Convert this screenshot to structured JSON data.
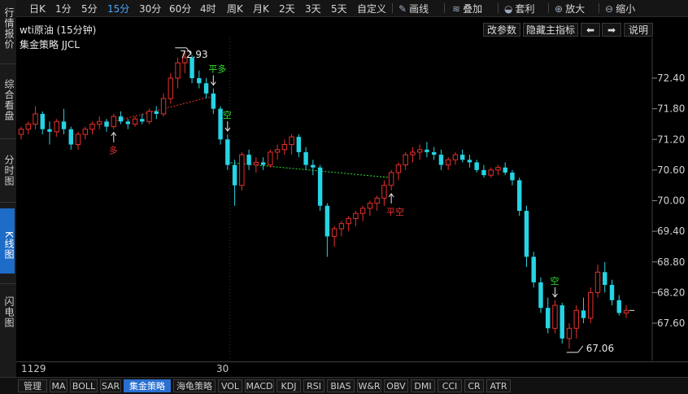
{
  "sidebar": {
    "items": [
      {
        "label": "行情报价",
        "active": false
      },
      {
        "label": "综合看盘",
        "active": false
      },
      {
        "label": "分时图",
        "active": false
      },
      {
        "label": "K线图",
        "active": true
      },
      {
        "label": "闪电图",
        "active": false
      }
    ]
  },
  "toolbar": {
    "periods": [
      "日K",
      "1分",
      "5分",
      "15分",
      "30分",
      "60分",
      "4时",
      "周K",
      "月K",
      "2天",
      "3天",
      "5天",
      "自定义"
    ],
    "active_period": "15分",
    "tools": [
      {
        "label": "画线",
        "icon": "pencil-icon"
      },
      {
        "label": "叠加",
        "icon": "layers-icon"
      },
      {
        "label": "套利",
        "icon": "bag-icon"
      },
      {
        "label": "放大",
        "icon": "zoom-in-icon"
      },
      {
        "label": "缩小",
        "icon": "zoom-out-icon"
      }
    ]
  },
  "chart_header": {
    "title": "wti原油 (15分钟)",
    "strategy": "集金策略 JJCL",
    "buttons": {
      "params": "改参数",
      "hide": "隐藏主指标",
      "prev": "⬅",
      "next": "➡",
      "help": "说明"
    }
  },
  "chart_data": {
    "type": "candlestick",
    "ylim": [
      67.0,
      72.9
    ],
    "yticks": [
      "72.40",
      "71.80",
      "71.20",
      "70.60",
      "70.00",
      "69.40",
      "68.80",
      "68.20",
      "67.60"
    ],
    "xlabels": [
      {
        "label": "1129",
        "index": 0
      },
      {
        "label": "30",
        "index": 30
      }
    ],
    "colors": {
      "up": "#e8302c",
      "down": "#26d4e4",
      "grid": "#2a2a2a",
      "trend": "#ff3030",
      "trend2": "#31e231"
    },
    "annotations": [
      {
        "text": "72.93",
        "index": 23,
        "price": 72.93
      },
      {
        "text": "67.06",
        "index": 78,
        "price": 67.06
      }
    ],
    "signals": [
      {
        "text": "多",
        "index": 13,
        "dir": "up",
        "color": "#e8302c"
      },
      {
        "text": "平多",
        "index": 27,
        "dir": "down",
        "color": "#31e231"
      },
      {
        "text": "空",
        "index": 29,
        "dir": "down",
        "color": "#31e231"
      },
      {
        "text": "平空",
        "index": 52,
        "dir": "up",
        "color": "#e8302c"
      },
      {
        "text": "空",
        "index": 75,
        "dir": "down",
        "color": "#31e231"
      }
    ],
    "trendlines": [
      {
        "from": [
          13,
          71.55
        ],
        "to": [
          27,
          72.05
        ],
        "color": "#ff3030"
      },
      {
        "from": [
          29,
          70.75
        ],
        "to": [
          52,
          70.45
        ],
        "color": "#31e231"
      }
    ],
    "candles": [
      [
        71.3,
        71.45,
        71.2,
        71.4
      ],
      [
        71.4,
        71.55,
        71.3,
        71.5
      ],
      [
        71.5,
        71.85,
        71.4,
        71.7
      ],
      [
        71.7,
        71.75,
        71.3,
        71.4
      ],
      [
        71.4,
        71.55,
        71.1,
        71.35
      ],
      [
        71.35,
        71.6,
        71.25,
        71.55
      ],
      [
        71.55,
        71.8,
        71.3,
        71.4
      ],
      [
        71.4,
        71.45,
        71.0,
        71.1
      ],
      [
        71.1,
        71.35,
        71.0,
        71.3
      ],
      [
        71.3,
        71.45,
        71.2,
        71.4
      ],
      [
        71.4,
        71.55,
        71.3,
        71.5
      ],
      [
        71.5,
        71.65,
        71.4,
        71.55
      ],
      [
        71.55,
        71.6,
        71.35,
        71.45
      ],
      [
        71.45,
        71.7,
        71.4,
        71.65
      ],
      [
        71.65,
        71.75,
        71.5,
        71.55
      ],
      [
        71.55,
        71.6,
        71.4,
        71.5
      ],
      [
        71.5,
        71.65,
        71.45,
        71.6
      ],
      [
        71.6,
        71.7,
        71.5,
        71.55
      ],
      [
        71.55,
        71.8,
        71.5,
        71.75
      ],
      [
        71.75,
        71.85,
        71.6,
        71.7
      ],
      [
        71.7,
        72.1,
        71.65,
        72.0
      ],
      [
        72.0,
        72.5,
        71.9,
        72.4
      ],
      [
        72.4,
        72.8,
        72.2,
        72.7
      ],
      [
        72.7,
        72.93,
        72.5,
        72.8
      ],
      [
        72.8,
        72.85,
        72.3,
        72.4
      ],
      [
        72.4,
        72.55,
        72.2,
        72.3
      ],
      [
        72.3,
        72.4,
        72.0,
        72.1
      ],
      [
        72.1,
        72.2,
        71.7,
        71.8
      ],
      [
        71.8,
        71.85,
        71.1,
        71.2
      ],
      [
        71.2,
        71.3,
        70.6,
        70.7
      ],
      [
        70.7,
        70.8,
        69.9,
        70.3
      ],
      [
        70.3,
        70.95,
        70.2,
        70.9
      ],
      [
        70.9,
        71.0,
        70.6,
        70.7
      ],
      [
        70.7,
        70.85,
        70.55,
        70.75
      ],
      [
        70.75,
        70.85,
        70.6,
        70.7
      ],
      [
        70.7,
        71.0,
        70.65,
        70.95
      ],
      [
        70.95,
        71.1,
        70.8,
        71.0
      ],
      [
        71.0,
        71.2,
        70.9,
        71.1
      ],
      [
        71.1,
        71.3,
        70.9,
        71.25
      ],
      [
        71.25,
        71.3,
        70.85,
        70.95
      ],
      [
        70.95,
        71.05,
        70.6,
        70.7
      ],
      [
        70.7,
        70.8,
        70.5,
        70.65
      ],
      [
        70.65,
        70.7,
        69.8,
        69.9
      ],
      [
        69.9,
        69.95,
        68.9,
        69.3
      ],
      [
        69.3,
        69.5,
        69.1,
        69.45
      ],
      [
        69.45,
        69.6,
        69.3,
        69.55
      ],
      [
        69.55,
        69.7,
        69.4,
        69.65
      ],
      [
        69.65,
        69.8,
        69.5,
        69.75
      ],
      [
        69.75,
        69.9,
        69.6,
        69.85
      ],
      [
        69.85,
        70.0,
        69.7,
        69.95
      ],
      [
        69.95,
        70.1,
        69.8,
        70.05
      ],
      [
        70.05,
        70.4,
        69.9,
        70.3
      ],
      [
        70.3,
        70.6,
        70.2,
        70.55
      ],
      [
        70.55,
        70.75,
        70.4,
        70.7
      ],
      [
        70.7,
        70.95,
        70.6,
        70.9
      ],
      [
        70.9,
        71.05,
        70.75,
        70.95
      ],
      [
        70.95,
        71.1,
        70.8,
        71.0
      ],
      [
        71.0,
        71.15,
        70.85,
        70.95
      ],
      [
        70.95,
        71.05,
        70.8,
        70.9
      ],
      [
        70.9,
        71.0,
        70.6,
        70.7
      ],
      [
        70.7,
        70.85,
        70.6,
        70.8
      ],
      [
        70.8,
        70.95,
        70.7,
        70.9
      ],
      [
        70.9,
        71.0,
        70.75,
        70.8
      ],
      [
        70.8,
        70.9,
        70.65,
        70.75
      ],
      [
        70.75,
        70.8,
        70.55,
        70.6
      ],
      [
        70.6,
        70.7,
        70.45,
        70.5
      ],
      [
        70.5,
        70.65,
        70.45,
        70.6
      ],
      [
        70.6,
        70.7,
        70.5,
        70.65
      ],
      [
        70.65,
        70.75,
        70.5,
        70.55
      ],
      [
        70.55,
        70.6,
        70.3,
        70.4
      ],
      [
        70.4,
        70.45,
        69.7,
        69.8
      ],
      [
        69.8,
        69.9,
        68.7,
        68.9
      ],
      [
        68.9,
        69.0,
        68.3,
        68.4
      ],
      [
        68.4,
        68.5,
        67.8,
        67.9
      ],
      [
        67.9,
        68.1,
        67.4,
        67.5
      ],
      [
        67.5,
        68.05,
        67.4,
        67.95
      ],
      [
        67.95,
        68.0,
        67.2,
        67.3
      ],
      [
        67.3,
        67.6,
        67.1,
        67.5
      ],
      [
        67.5,
        67.95,
        67.3,
        67.85
      ],
      [
        67.85,
        68.1,
        67.6,
        67.7
      ],
      [
        67.7,
        68.3,
        67.6,
        68.2
      ],
      [
        68.2,
        68.75,
        68.1,
        68.6
      ],
      [
        68.6,
        68.8,
        68.2,
        68.35
      ],
      [
        68.35,
        68.45,
        67.95,
        68.05
      ],
      [
        68.05,
        68.15,
        67.75,
        67.8
      ],
      [
        67.8,
        67.95,
        67.7,
        67.85
      ]
    ]
  },
  "bottom_tabs": [
    "管理",
    "MA",
    "BOLL",
    "SAR",
    "集金策略",
    "海龟策略",
    "VOL",
    "MACD",
    "KDJ",
    "RSI",
    "BIAS",
    "W&R",
    "OBV",
    "DMI",
    "CCI",
    "CR",
    "ATR"
  ],
  "active_tab": "集金策略"
}
